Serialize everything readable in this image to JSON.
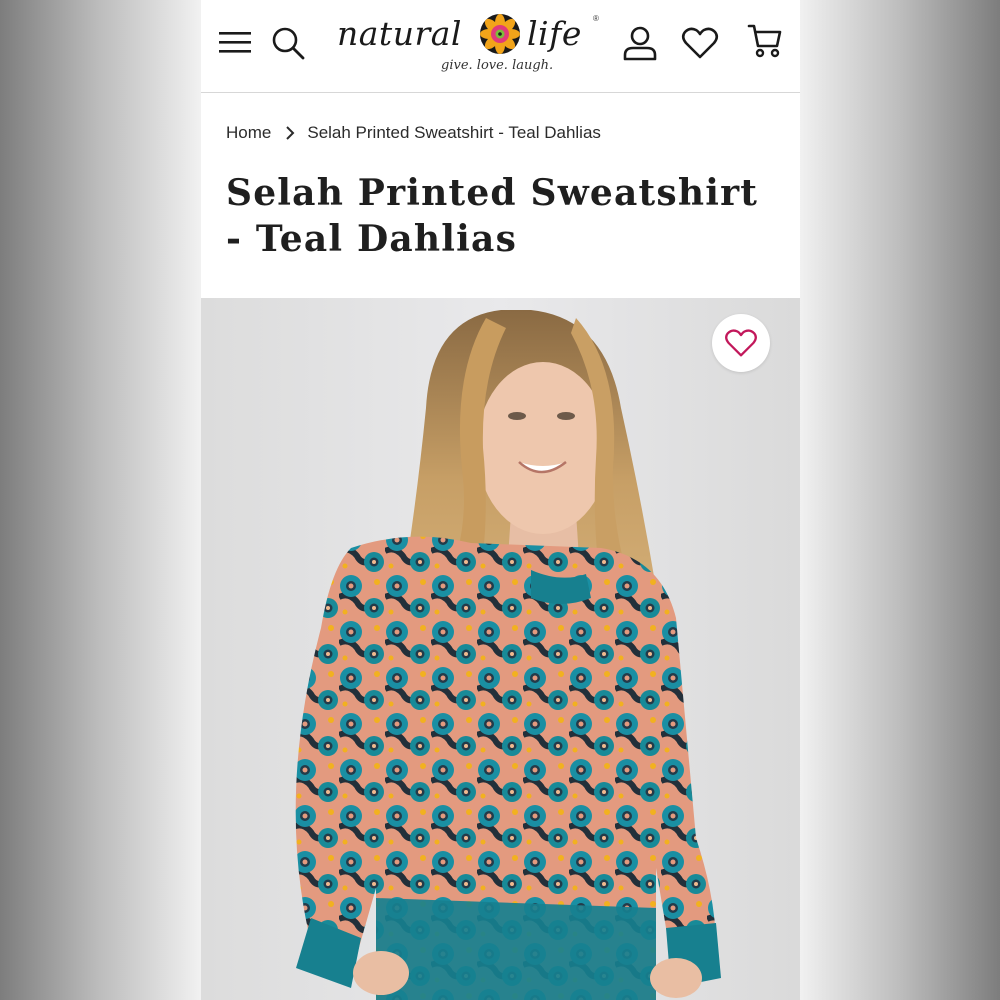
{
  "header": {
    "menu_icon": "hamburger-menu-icon",
    "search_icon": "search-icon",
    "logo": {
      "word_left": "natural",
      "word_right": "life",
      "registered": "®",
      "tagline": "give. love. laugh."
    },
    "account_icon": "user-account-icon",
    "wishlist_icon": "heart-icon",
    "cart_icon": "shopping-cart-icon"
  },
  "breadcrumb": {
    "home": "Home",
    "separator_icon": "chevron-right-icon",
    "current": "Selah Printed Sweatshirt - Teal Dahlias"
  },
  "product": {
    "title": "Selah Printed Sweatshirt - Teal Dahlias",
    "image_alt": "Woman wearing teal and coral floral print sweatshirt",
    "wishlist_button_icon": "heart-outline-icon"
  },
  "colors": {
    "accent_pink": "#c2185b",
    "sweatshirt_teal": "#17808f",
    "print_coral": "#e39a7f",
    "background": "#ffffff"
  }
}
